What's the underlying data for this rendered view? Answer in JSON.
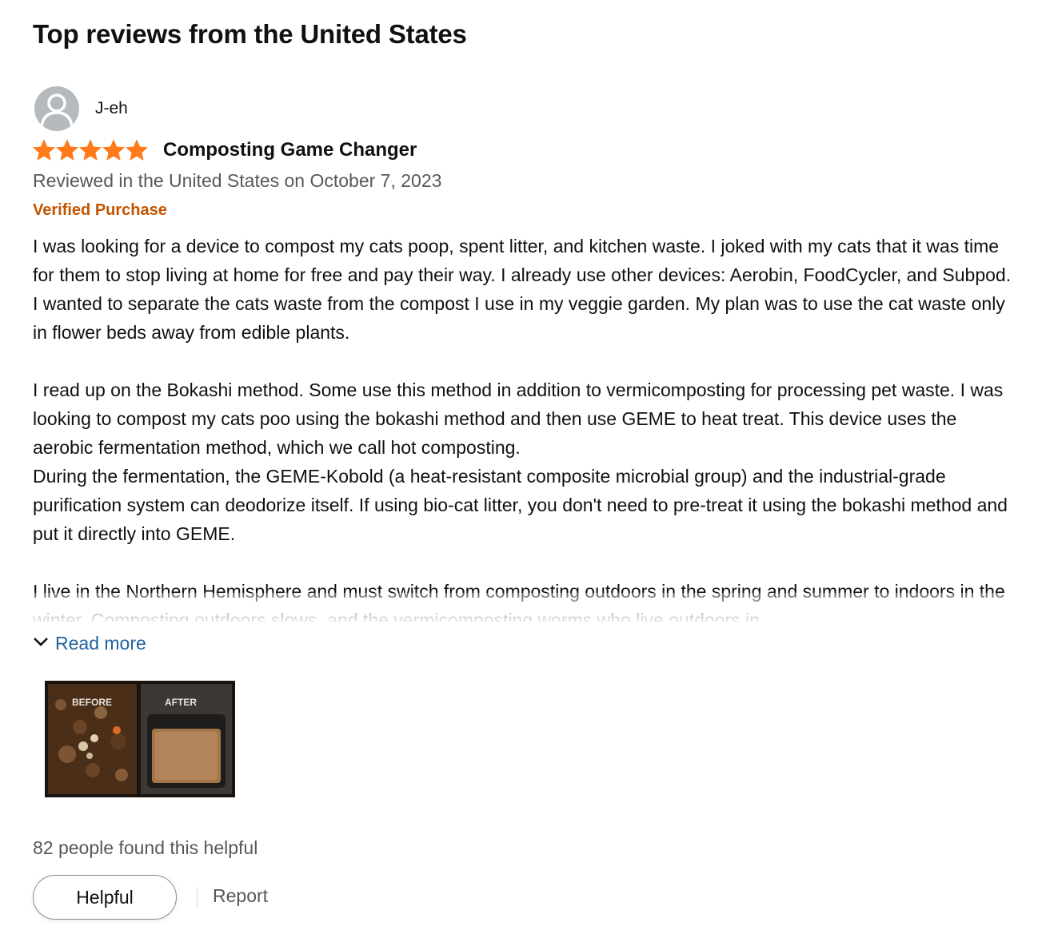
{
  "section_title": "Top reviews from the United States",
  "review": {
    "author": "J-eh",
    "avatar_icon": "default-profile-avatar-icon",
    "rating": 5,
    "rating_max": 5,
    "star_color": "#ff7a1a",
    "title": "Composting Game Changer",
    "date": "Reviewed in the United States on October 7, 2023",
    "verified": "Verified Purchase",
    "body": [
      "I was looking for a device to compost my cats poop, spent litter, and kitchen waste. I joked with my cats that it was time for them to stop living at home for free and pay their way. I already use other devices: Aerobin, FoodCycler, and Subpod. I wanted to separate the cats waste from the compost I use in my veggie garden. My plan was to use the cat waste only in flower beds away from edible plants.",
      "I read up on the Bokashi method. Some use this method in addition to vermicomposting for processing pet waste. I was looking to compost my cats poo using the bokashi method and then use GEME to heat treat. This device uses the aerobic fermentation method, which we call hot composting.",
      "During the fermentation, the GEME-Kobold (a heat-resistant composite microbial group) and the industrial-grade purification system can deodorize itself. If using bio-cat litter, you don't need to pre-treat it using the bokashi method and put it directly into GEME.",
      "I live in the Northern Hemisphere and must switch from composting outdoors in the spring and summer to indoors in the winter. Composting outdoors slows, and the vermicomposting worms who live outdoors in"
    ],
    "read_more": "Read more",
    "image": {
      "before_label": "BEFORE",
      "after_label": "AFTER"
    },
    "helpful_count": "82 people found this helpful",
    "helpful_button": "Helpful",
    "report_link": "Report"
  },
  "colors": {
    "text": "#0f1111",
    "secondary_text": "#565959",
    "verified": "#c45500",
    "link": "#2162a1"
  }
}
